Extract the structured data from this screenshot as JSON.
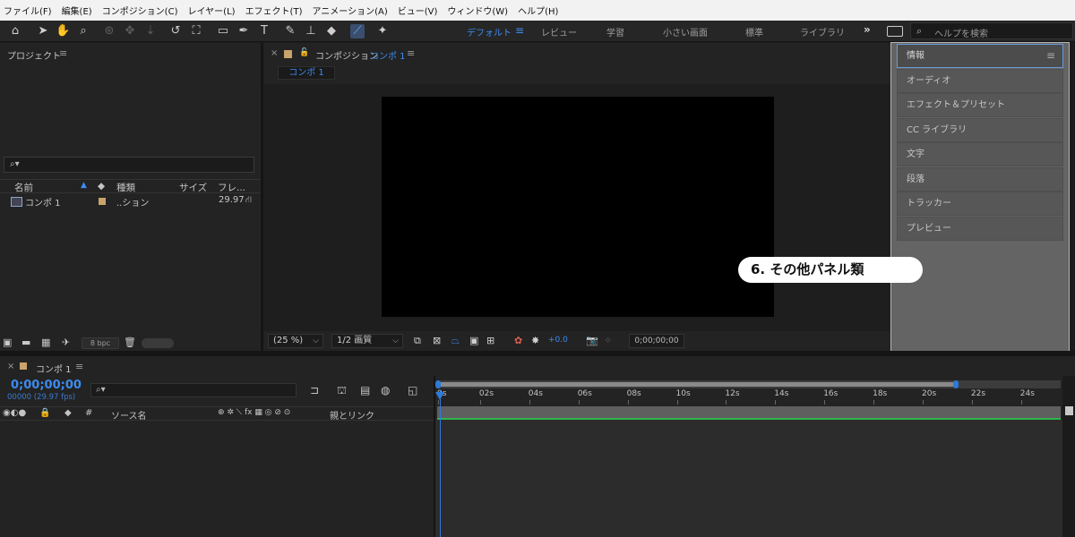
{
  "menu": [
    "ファイル(F)",
    "編集(E)",
    "コンポジション(C)",
    "レイヤー(L)",
    "エフェクト(T)",
    "アニメーション(A)",
    "ビュー(V)",
    "ウィンドウ(W)",
    "ヘルプ(H)"
  ],
  "toolbar": {
    "tools": [
      {
        "icon": "home-icon",
        "glyph": "⌂"
      },
      {
        "icon": "selection-tool-icon",
        "glyph": "➤"
      },
      {
        "icon": "hand-tool-icon",
        "glyph": "✋"
      },
      {
        "icon": "zoom-tool-icon",
        "glyph": "⌕"
      },
      {
        "icon": "orbit-camera-icon",
        "glyph": "⊛"
      },
      {
        "icon": "pan-camera-icon",
        "glyph": "✥"
      },
      {
        "icon": "dolly-camera-icon",
        "glyph": "⇣"
      },
      {
        "icon": "rotate-tool-icon",
        "glyph": "↺"
      },
      {
        "icon": "anchor-point-tool-icon",
        "glyph": "⛶"
      },
      {
        "icon": "rectangle-tool-icon",
        "glyph": "▭"
      },
      {
        "icon": "pen-tool-icon",
        "glyph": "✒"
      },
      {
        "icon": "type-tool-icon",
        "glyph": "T"
      },
      {
        "icon": "brush-tool-icon",
        "glyph": "✎"
      },
      {
        "icon": "clone-stamp-tool-icon",
        "glyph": "⊥"
      },
      {
        "icon": "eraser-tool-icon",
        "glyph": "◆"
      },
      {
        "icon": "roto-brush-tool-icon",
        "glyph": "⟋"
      },
      {
        "icon": "puppet-pin-tool-icon",
        "glyph": "✦"
      }
    ],
    "workspaces": [
      "デフォルト",
      "レビュー",
      "学習",
      "小さい画面",
      "標準",
      "ライブラリ"
    ],
    "workspace_menu_glyph": "≡",
    "more_glyph": "»",
    "help_search_placeholder": "ヘルプを検索",
    "search_glyph": "⌕"
  },
  "project": {
    "title": "プロジェクト",
    "menu_glyph": "≡",
    "search_glyph": "⌕▾",
    "columns": [
      "名前",
      "種類",
      "サイズ",
      "フレ..."
    ],
    "sort_glyph": "▲",
    "label_glyph": "◆",
    "items": [
      {
        "name": "コンポ 1",
        "type": "..ション",
        "fps": "29.97"
      }
    ],
    "bpc": "8 bpc",
    "trash_glyph": "🗑"
  },
  "comp": {
    "close_glyph": "×",
    "lock_glyph": "🔓",
    "title_prefix": "コンポジション",
    "title_name": "コンポ 1",
    "menu_glyph": "≡",
    "tab": "コンポ 1",
    "zoom": "(25 %)",
    "resolution": "1/2 画質",
    "exposure": "+0.0",
    "timecode": "0;00;00;00"
  },
  "panels": {
    "items": [
      "情報",
      "オーディオ",
      "エフェクト＆プリセット",
      "CC ライブラリ",
      "文字",
      "段落",
      "トラッカー",
      "プレビュー"
    ],
    "selected": 0,
    "menu_glyph": "≡"
  },
  "annotation": "6. その他パネル類",
  "timeline": {
    "close_glyph": "×",
    "tab": "コンポ 1",
    "menu_glyph": "≡",
    "time": "0;00;00;00",
    "fps": "00000 (29.97 fps)",
    "search_glyph": "⌕▾",
    "columns": [
      "ソース名",
      "親とリンク"
    ],
    "hash_glyph": "#",
    "ruler": [
      "0s",
      "02s",
      "04s",
      "06s",
      "08s",
      "10s",
      "12s",
      "14s",
      "16s",
      "18s",
      "20s",
      "22s",
      "24s"
    ],
    "switch_glyphs": "⊕ ✲ ⟍ fx ▦ ◎ ⊘ ⊙"
  },
  "colors": {
    "accent": "#3b8cf0",
    "green": "#2fb74a",
    "panel_bg": "#232323"
  }
}
